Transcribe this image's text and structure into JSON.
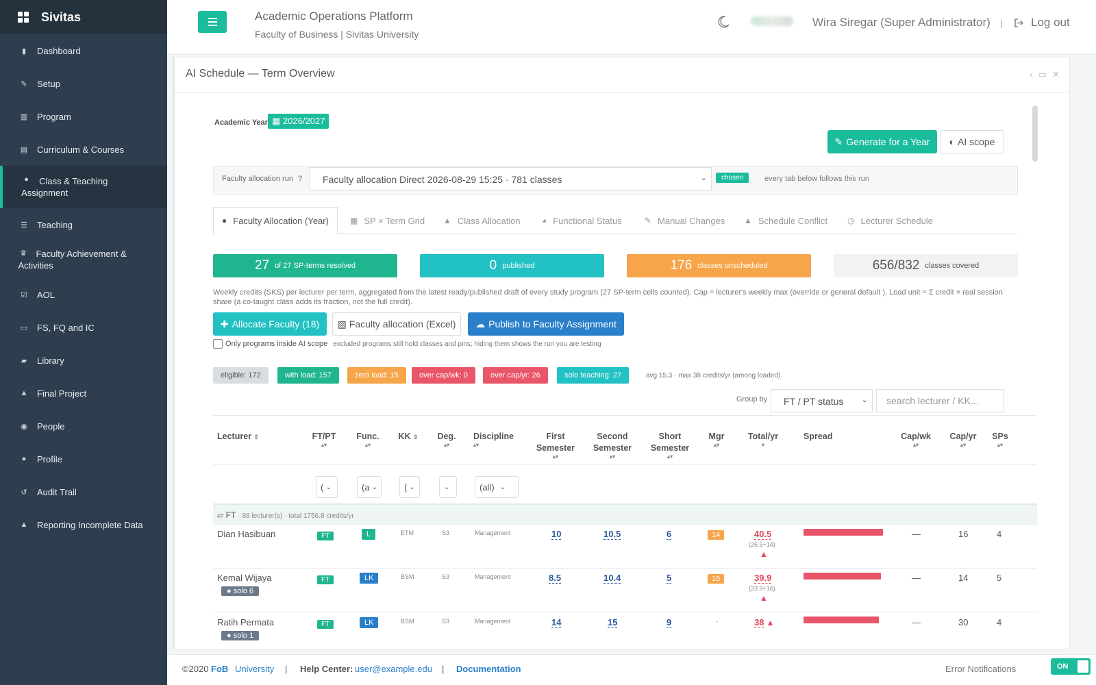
{
  "sidebar": {
    "brand": "Sivitas",
    "items": [
      {
        "label": "Dashboard",
        "icon": "bar-chart-icon"
      },
      {
        "label": "Setup",
        "icon": "wrench-icon"
      },
      {
        "label": "Program",
        "icon": "bank-icon"
      },
      {
        "label": "Curriculum & Courses",
        "icon": "document-icon"
      },
      {
        "label": "Class & Teaching Assignment",
        "icon": "users-icon",
        "active": true
      },
      {
        "label": "Teaching",
        "icon": "list-icon"
      },
      {
        "label": "Faculty Achievement & Activities",
        "icon": "trophy-icon"
      },
      {
        "label": "AOL",
        "icon": "check-square-icon"
      },
      {
        "label": "FS, FQ and IC",
        "icon": "id-card-icon"
      },
      {
        "label": "Library",
        "icon": "book-icon"
      },
      {
        "label": "Final Project",
        "icon": "graduation-cap-icon"
      },
      {
        "label": "People",
        "icon": "user-circle-icon"
      },
      {
        "label": "Profile",
        "icon": "user-icon"
      },
      {
        "label": "Audit Trail",
        "icon": "history-icon"
      },
      {
        "label": "Reporting Incomplete Data",
        "icon": "warning-icon"
      }
    ]
  },
  "header": {
    "title": "Academic Operations Platform",
    "subtitle": "Faculty of Business | Sivitas University",
    "user": "Wira Siregar (Super Administrator)",
    "separator": "|",
    "logout": "Log out"
  },
  "panel": {
    "title": "AI Schedule — Term Overview",
    "academic_year_label": "Academic Year",
    "academic_year": "2026/2027",
    "generate_button": "Generate for a Year",
    "ai_scope_button": "AI scope",
    "run_label": "Faculty allocation run",
    "run_value": "Faculty allocation Direct 2026-08-29 15:25 · 781 classes",
    "chosen": "chosen",
    "run_note": "every tab below follows this run",
    "tabs": [
      {
        "label": "Faculty Allocation (Year)",
        "icon": "user-icon"
      },
      {
        "label": "SP × Term Grid",
        "icon": "grid-icon"
      },
      {
        "label": "Class Allocation",
        "icon": "graduation-cap-icon"
      },
      {
        "label": "Functional Status",
        "icon": "pie-chart-icon"
      },
      {
        "label": "Manual Changes",
        "icon": "edit-icon"
      },
      {
        "label": "Schedule Conflict",
        "icon": "warning-icon"
      },
      {
        "label": "Lecturer Schedule",
        "icon": "clock-icon"
      }
    ],
    "stats": [
      {
        "value": "27",
        "label": "of 27 SP-terms resolved",
        "color": "#1fb58f"
      },
      {
        "value": "0",
        "label": "published",
        "color": "#22c1c3"
      },
      {
        "value": "176",
        "label": "classes unscheduled",
        "color": "#f6a54b"
      },
      {
        "value": "656/832",
        "label": "classes covered",
        "color": "#f2f2f2"
      }
    ],
    "description": "Weekly credits (SKS) per lecturer per term, aggregated from the latest ready/published draft of every study program (27 SP-term cells counted). Cap = lecturer's weekly max (override or general default ). Load unit = Σ credit × real session share (a co-taught class adds its fraction, not the full credit).",
    "allocate_button": "Allocate Faculty (18)",
    "excel_button": "Faculty allocation (Excel)",
    "publish_button": "Publish to Faculty Assignment",
    "only_scope_label": "Only programs inside AI scope",
    "only_scope_note": "excluded programs still hold classes and pins; hiding them shows the run you are testing",
    "pills": [
      {
        "label": "eligible: 172",
        "color": "#d9dde1",
        "text": "#555"
      },
      {
        "label": "with load: 157",
        "color": "#1fb58f",
        "text": "#fff"
      },
      {
        "label": "zero load: 15",
        "color": "#f6a54b",
        "text": "#fff"
      },
      {
        "label": "over cap/wk: 0",
        "color": "#e95569",
        "text": "#fff"
      },
      {
        "label": "over cap/yr: 26",
        "color": "#e95569",
        "text": "#fff"
      },
      {
        "label": "solo teaching: 27",
        "color": "#22c1c3",
        "text": "#fff"
      }
    ],
    "avg": "avg 15.3 · max 38 credits/yr (among loaded)",
    "group_by_label": "Group by",
    "group_by_value": "FT / PT status",
    "search_placeholder": "search lecturer / KK...",
    "columns": [
      "Lecturer",
      "FT/PT",
      "Func.",
      "KK",
      "Deg.",
      "Discipline",
      "First Semester",
      "Second Semester",
      "Short Semester",
      "Mgr",
      "Total/yr",
      "Spread",
      "Cap/wk",
      "Cap/yr",
      "SPs"
    ],
    "filters": {
      "ftpt": "(",
      "func": "(a",
      "kk": "(",
      "deg": "",
      "discipline": "(all)"
    },
    "group_row": {
      "label": "FT",
      "meta": "· 88 lecturer(s) · total 1756.8 credits/yr"
    },
    "rows": [
      {
        "name": "Dian Hasibuan",
        "ftpt": "FT",
        "func": "L",
        "kk": "ETM",
        "deg": "S3",
        "discipline": "Management",
        "first": "10",
        "second": "10.5",
        "short": "6",
        "mgr": "14",
        "total": "40.5",
        "total_sub": "(26.5+14)",
        "spread": 0.95,
        "capwk": "—",
        "capyr": "16",
        "sps": "4",
        "solo": ""
      },
      {
        "name": "Kemal Wijaya",
        "ftpt": "FT",
        "func": "LK",
        "kk": "BSM",
        "deg": "S3",
        "discipline": "Management",
        "first": "8.5",
        "second": "10.4",
        "short": "5",
        "mgr": "16",
        "total": "39.9",
        "total_sub": "(23.9+16)",
        "spread": 0.93,
        "capwk": "—",
        "capyr": "14",
        "sps": "5",
        "solo": "solo 6"
      },
      {
        "name": "Ratih Permata",
        "ftpt": "FT",
        "func": "LK",
        "kk": "BSM",
        "deg": "S3",
        "discipline": "Management",
        "first": "14",
        "second": "15",
        "short": "9",
        "mgr": "-",
        "total": "38",
        "total_sub": "",
        "spread": 0.9,
        "capwk": "—",
        "capyr": "30",
        "sps": "4",
        "solo": "solo 1"
      }
    ]
  },
  "footer": {
    "copyright": "©2020",
    "fob": "FoB",
    "university": "University",
    "sep": "|",
    "help_label": "Help Center:",
    "help_email": "user@example.edu",
    "documentation": "Documentation",
    "error_notifications": "Error Notifications",
    "toggle": "ON"
  }
}
